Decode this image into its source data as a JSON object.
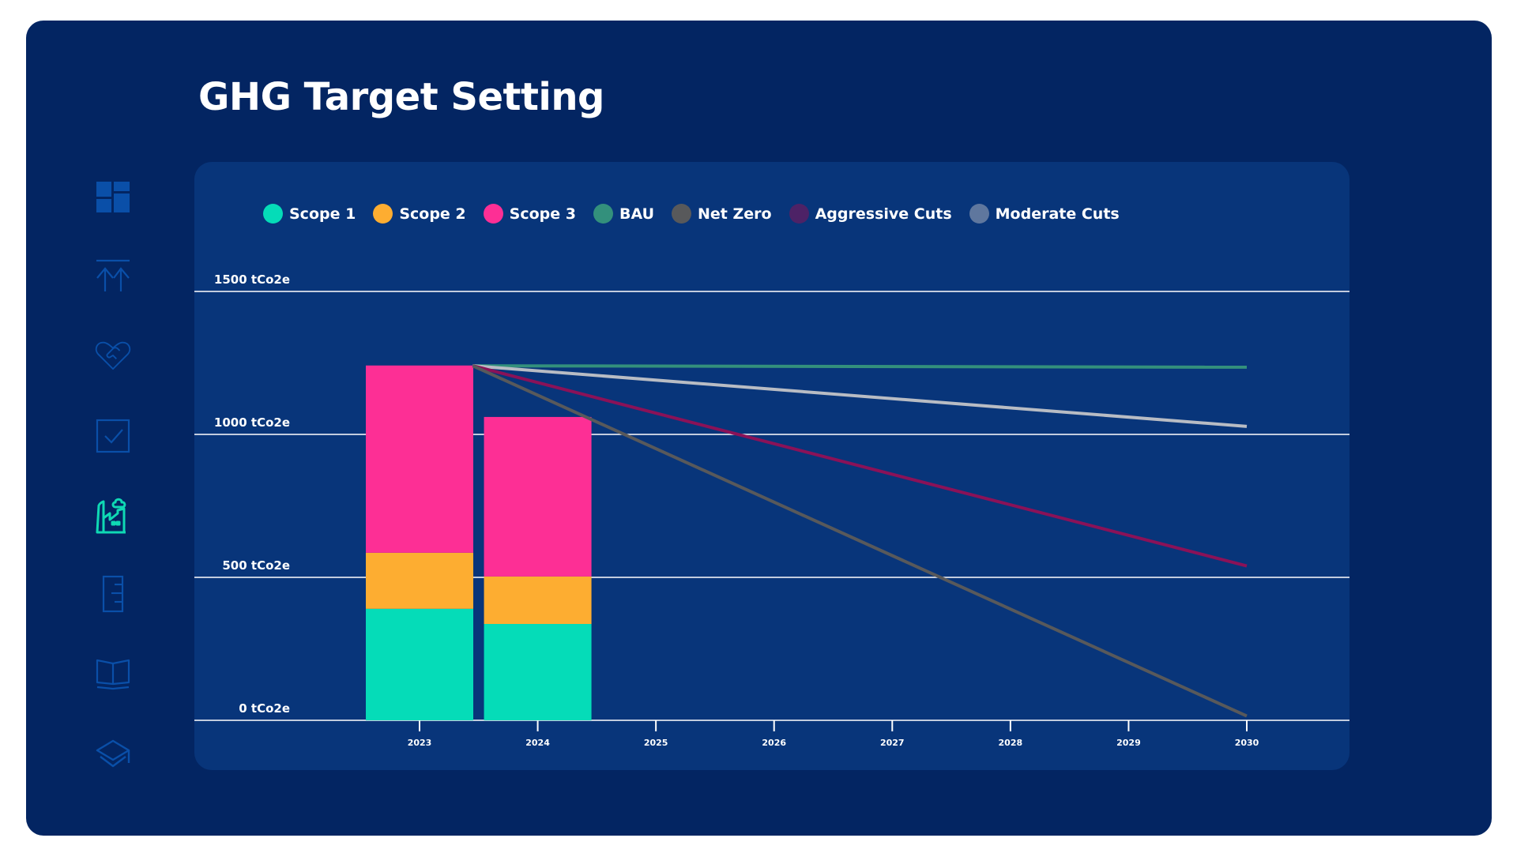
{
  "page": {
    "title": "GHG Target Setting"
  },
  "sidebar": {
    "items": [
      {
        "icon": "dashboard-icon",
        "active": false
      },
      {
        "icon": "upload-arrows-icon",
        "active": false
      },
      {
        "icon": "heart-handshake-icon",
        "active": false
      },
      {
        "icon": "checkbox-icon",
        "active": false
      },
      {
        "icon": "factory-emissions-icon",
        "active": true
      },
      {
        "icon": "ruler-icon",
        "active": false
      },
      {
        "icon": "open-book-icon",
        "active": false
      },
      {
        "icon": "graduation-cap-icon",
        "active": false
      }
    ],
    "colors": {
      "inactive": "#0a4fa8",
      "active": "#0fd9b4"
    }
  },
  "chart_data": {
    "type": "bar",
    "title": "GHG Target Setting",
    "xlabel": "",
    "ylabel": "",
    "ylim": [
      0,
      1500
    ],
    "xlim": [
      2022.2,
      2030.8
    ],
    "grid": true,
    "legend_position": "top-left",
    "y_ticks": [
      {
        "value": 0,
        "label": "0 tCo2e"
      },
      {
        "value": 500,
        "label": "500 tCo2e"
      },
      {
        "value": 1000,
        "label": "1000 tCo2e"
      },
      {
        "value": 1500,
        "label": "1500 tCo2e"
      }
    ],
    "categories": [
      "2023",
      "2024",
      "2025",
      "2026",
      "2027",
      "2028",
      "2029",
      "2030"
    ],
    "legend": [
      {
        "name": "Scope 1",
        "color": "#05dcb8"
      },
      {
        "name": "Scope 2",
        "color": "#fdad31"
      },
      {
        "name": "Scope 3",
        "color": "#fd2f95"
      },
      {
        "name": "BAU",
        "color": "#33907c"
      },
      {
        "name": "Net Zero",
        "color": "#58595b"
      },
      {
        "name": "Aggressive Cuts",
        "color": "#4d2266"
      },
      {
        "name": "Moderate Cuts",
        "color": "#5f779e"
      }
    ],
    "stacked_bars": {
      "categories": [
        "2023",
        "2024"
      ],
      "series": [
        {
          "name": "Scope 1",
          "color": "#05dcb8",
          "values": [
            390,
            337
          ]
        },
        {
          "name": "Scope 2",
          "color": "#fdad31",
          "values": [
            196,
            166
          ]
        },
        {
          "name": "Scope 3",
          "color": "#fd2f95",
          "values": [
            655,
            558
          ]
        }
      ]
    },
    "lines": [
      {
        "name": "BAU",
        "color": "#33907c",
        "x": [
          2023.45,
          2030
        ],
        "y": [
          1240,
          1235
        ]
      },
      {
        "name": "Moderate Cuts",
        "color": "#b8bcc4",
        "x": [
          2023.45,
          2030
        ],
        "y": [
          1240,
          1028
        ]
      },
      {
        "name": "Aggressive Cuts",
        "color": "#8a1258",
        "x": [
          2023.45,
          2030
        ],
        "y": [
          1240,
          540
        ]
      },
      {
        "name": "Net Zero",
        "color": "#58595b",
        "x": [
          2023.45,
          2030
        ],
        "y": [
          1240,
          15
        ]
      }
    ],
    "colors": {
      "gridline": "#ffffff",
      "axis": "#ffffff"
    }
  }
}
